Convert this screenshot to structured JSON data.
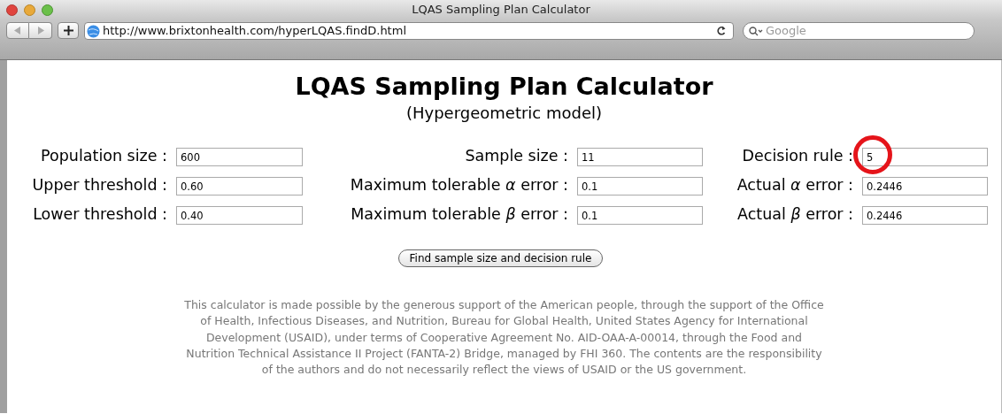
{
  "window": {
    "title": "LQAS Sampling Plan Calculator"
  },
  "toolbar": {
    "url": "http://www.brixtonhealth.com/hyperLQAS.findD.html",
    "search_placeholder": "Google"
  },
  "page": {
    "heading": "LQAS Sampling Plan Calculator",
    "subheading": "(Hypergeometric model)",
    "fields": [
      [
        {
          "label": "Population size :",
          "value": "600",
          "circled": false
        },
        {
          "label": "Sample size :",
          "value": "11",
          "circled": false
        },
        {
          "label": "Decision rule :",
          "value": "5",
          "circled": true
        }
      ],
      [
        {
          "label": "Upper threshold :",
          "value": "0.60",
          "circled": false
        },
        {
          "label": "Maximum tolerable *α* error :",
          "value": "0.1",
          "circled": false
        },
        {
          "label": "Actual *α* error :",
          "value": "0.2446",
          "circled": false
        }
      ],
      [
        {
          "label": "Lower threshold :",
          "value": "0.40",
          "circled": false
        },
        {
          "label": "Maximum tolerable *β* error :",
          "value": "0.1",
          "circled": false
        },
        {
          "label": "Actual *β* error :",
          "value": "0.2446",
          "circled": false
        }
      ]
    ],
    "button": "Find sample size and decision rule",
    "footer": [
      "This calculator is made possible by the generous support of the American people, through the support of the Office",
      "of Health, Infectious Diseases, and Nutrition, Bureau for Global Health, United States Agency for International",
      "Development (USAID), under terms of Cooperative Agreement No. AID-OAA-A-00014, through the Food and",
      "Nutrition Technical Assistance II Project (FANTA-2) Bridge, managed by FHI 360. The contents are the responsibility",
      "of the authors and do not necessarily reflect the views of USAID or the US government."
    ]
  }
}
